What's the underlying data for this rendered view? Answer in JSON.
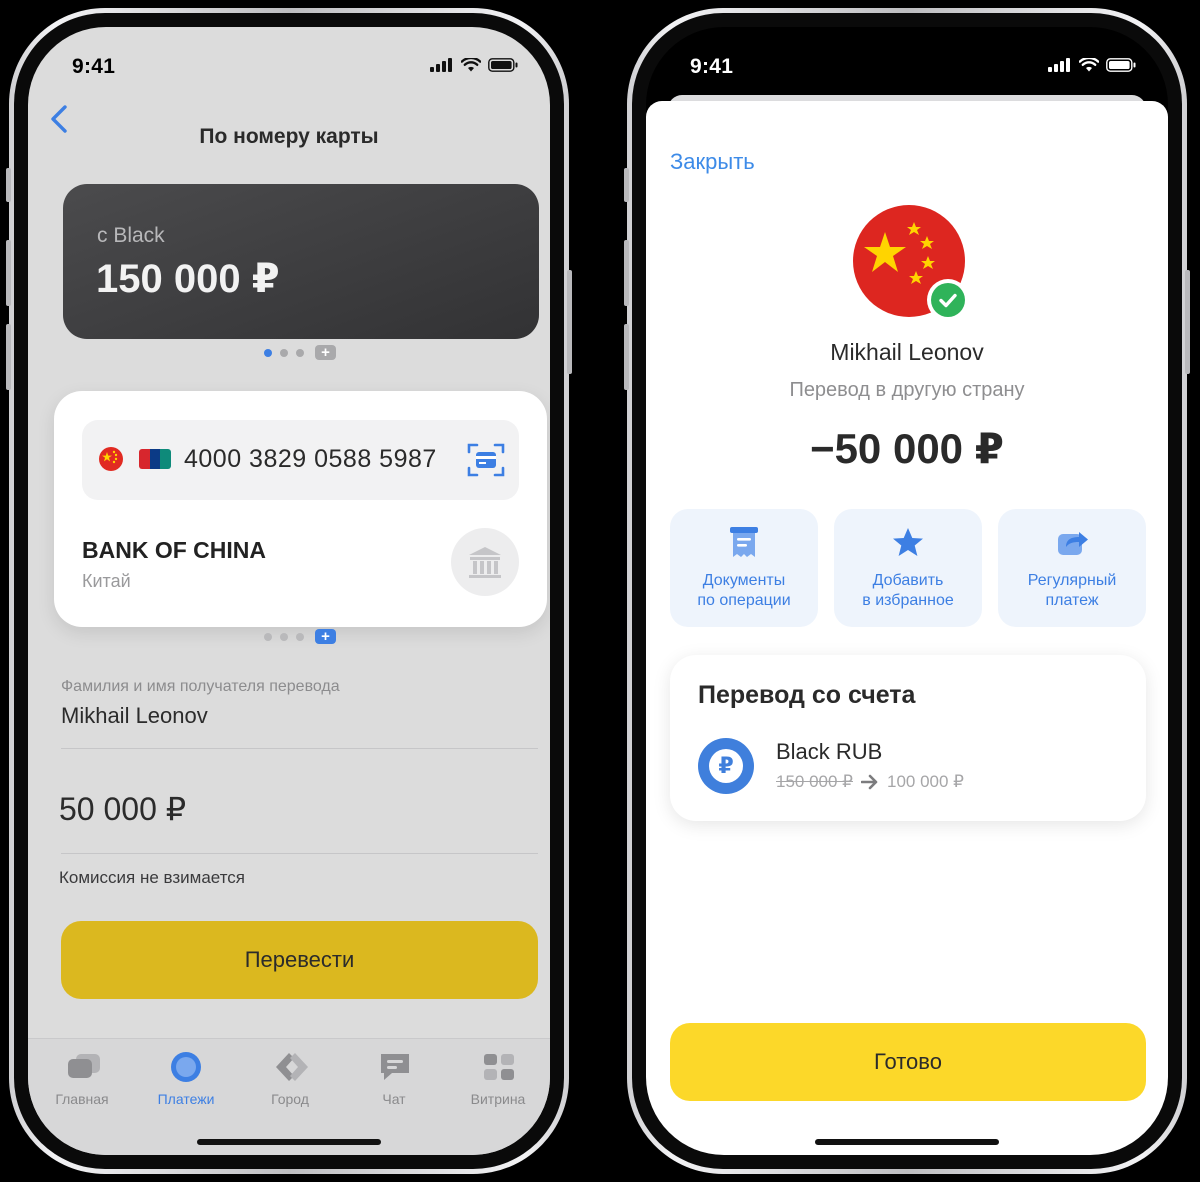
{
  "status_bar": {
    "time": "9:41"
  },
  "left_screen": {
    "header": {
      "title": "По номеру карты"
    },
    "source_card": {
      "label": "с Black",
      "balance": "150 000 ₽"
    },
    "recipient_card": {
      "card_number": "4000 3829 0588 5987",
      "bank_name": "BANK OF CHINA",
      "country": "Китай",
      "payment_system": "UnionPay"
    },
    "recipient_name": {
      "label": "Фамилия и имя получателя перевода",
      "value": "Mikhail Leonov"
    },
    "amount": "50 000 ₽",
    "commission": "Комиссия не взимается",
    "submit_label": "Перевести",
    "tabbar": [
      {
        "label": "Главная",
        "icon": "home-icon",
        "active": false
      },
      {
        "label": "Платежи",
        "icon": "payments-icon",
        "active": true
      },
      {
        "label": "Город",
        "icon": "city-icon",
        "active": false
      },
      {
        "label": "Чат",
        "icon": "chat-icon",
        "active": false
      },
      {
        "label": "Витрина",
        "icon": "showcase-icon",
        "active": false
      }
    ]
  },
  "right_screen": {
    "close_label": "Закрыть",
    "recipient_name": "Mikhail Leonov",
    "operation_type": "Перевод в другую страну",
    "amount": "−50 000 ₽",
    "actions": [
      {
        "label_line1": "Документы",
        "label_line2": "по операции",
        "icon": "document-icon"
      },
      {
        "label_line1": "Добавить",
        "label_line2": "в избранное",
        "icon": "star-icon"
      },
      {
        "label_line1": "Регулярный",
        "label_line2": "платеж",
        "icon": "repeat-icon"
      }
    ],
    "from_account": {
      "title": "Перевод со счета",
      "account_name": "Black RUB",
      "balance_before": "150 000 ₽",
      "balance_after": "100 000 ₽",
      "currency_symbol": "₽"
    },
    "done_label": "Готово"
  },
  "colors": {
    "accent_blue": "#3d7fe3",
    "button_yellow_dim": "#dbb81f",
    "button_yellow": "#fcd829",
    "success_green": "#2fb35a",
    "flag_red": "#dd2620"
  }
}
